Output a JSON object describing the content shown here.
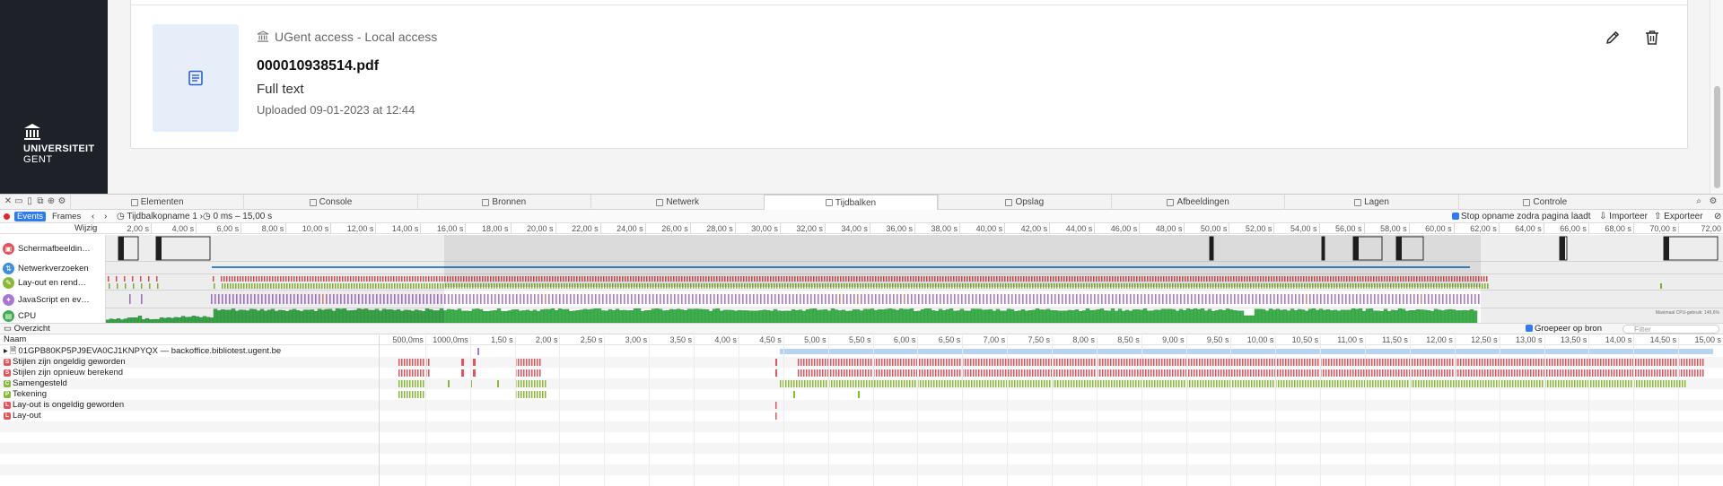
{
  "page": {
    "brand": {
      "line1": "UNIVERSITEIT",
      "line2": "GENT"
    },
    "card": {
      "access_label": "UGent access - Local access",
      "filename": "000010938514.pdf",
      "file_type": "Full text",
      "uploaded": "Uploaded 09-01-2023 at 12:44",
      "thumbnail_icon": "document-icon",
      "actions": [
        "pencil-icon",
        "trash-icon"
      ]
    }
  },
  "devtools": {
    "tabs": [
      "Elementen",
      "Console",
      "Bronnen",
      "Netwerk",
      "Tijdbalken",
      "Opslag",
      "Afbeeldingen",
      "Lagen",
      "Controle"
    ],
    "active_tab": "Tijdbalken",
    "toolbar": {
      "events": "Events",
      "frames": "Frames",
      "recording": "Tijdbalkopname 1",
      "range": "0 ms – 15,00 s",
      "stop_option": "Stop opname zodra pagina laadt",
      "import": "Importeer",
      "export": "Exporteer"
    },
    "ruler": {
      "edit_label": "Wijzig",
      "ticks": [
        "2,00 s",
        "4,00 s",
        "6,00 s",
        "8,00 s",
        "10,00 s",
        "12,00 s",
        "14,00 s",
        "16,00 s",
        "18,00 s",
        "20,00 s",
        "22,00 s",
        "24,00 s",
        "26,00 s",
        "28,00 s",
        "30,00 s",
        "32,00 s",
        "34,00 s",
        "36,00 s",
        "38,00 s",
        "40,00 s",
        "42,00 s",
        "44,00 s",
        "46,00 s",
        "48,00 s",
        "50,00 s",
        "52,00 s",
        "54,00 s",
        "56,00 s",
        "58,00 s",
        "60,00 s",
        "62,00 s",
        "64,00 s",
        "66,00 s",
        "68,00 s",
        "70,00 s",
        "72,00"
      ]
    },
    "tracks": [
      {
        "label": "Schermafbeeldin…",
        "color": "#e4525a"
      },
      {
        "label": "Netwerkverzoeken",
        "color": "#3d8fd6"
      },
      {
        "label": "Lay-out en rend…",
        "color": "#8ab93a"
      },
      {
        "label": "JavaScript en ev…",
        "color": "#a877d6"
      },
      {
        "label": "CPU",
        "color": "#3fae4e"
      }
    ],
    "cpu_max_label": "Maximaal CPU-gebruik: 145,6%",
    "overview": {
      "label": "Overzicht",
      "group_by_source": "Groepeer op bron",
      "filter_placeholder": "Filter"
    },
    "events_table": {
      "name_header": "Naam",
      "ticks": [
        "500,0ms",
        "1000,0ms",
        "1,50 s",
        "2,00 s",
        "2,50 s",
        "3,00 s",
        "3,50 s",
        "4,00 s",
        "4,50 s",
        "5,00 s",
        "5,50 s",
        "6,00 s",
        "6,50 s",
        "7,00 s",
        "7,50 s",
        "8,00 s",
        "8,50 s",
        "9,00 s",
        "9,50 s",
        "10,00 s",
        "10,50 s",
        "11,00 s",
        "11,50 s",
        "12,00 s",
        "12,50 s",
        "13,00 s",
        "13,50 s",
        "14,00 s",
        "14,50 s",
        "15,00 s"
      ],
      "rows": [
        {
          "badge": "",
          "name": "01GPB80KP5PJ9EVA0CJ1KNPYQX — backoffice.bibliotest.ugent.be",
          "color": "#8aa"
        },
        {
          "badge": "S",
          "name": "Stijlen zijn ongeldig geworden",
          "color": "#e4525a"
        },
        {
          "badge": "S",
          "name": "Stijlen zijn opnieuw berekend",
          "color": "#e4525a"
        },
        {
          "badge": "C",
          "name": "Samengesteld",
          "color": "#8ab93a"
        },
        {
          "badge": "P",
          "name": "Tekening",
          "color": "#8ab93a"
        },
        {
          "badge": "L",
          "name": "Lay-out is ongeldig geworden",
          "color": "#e4525a"
        },
        {
          "badge": "L",
          "name": "Lay-out",
          "color": "#e4525a"
        }
      ]
    }
  }
}
